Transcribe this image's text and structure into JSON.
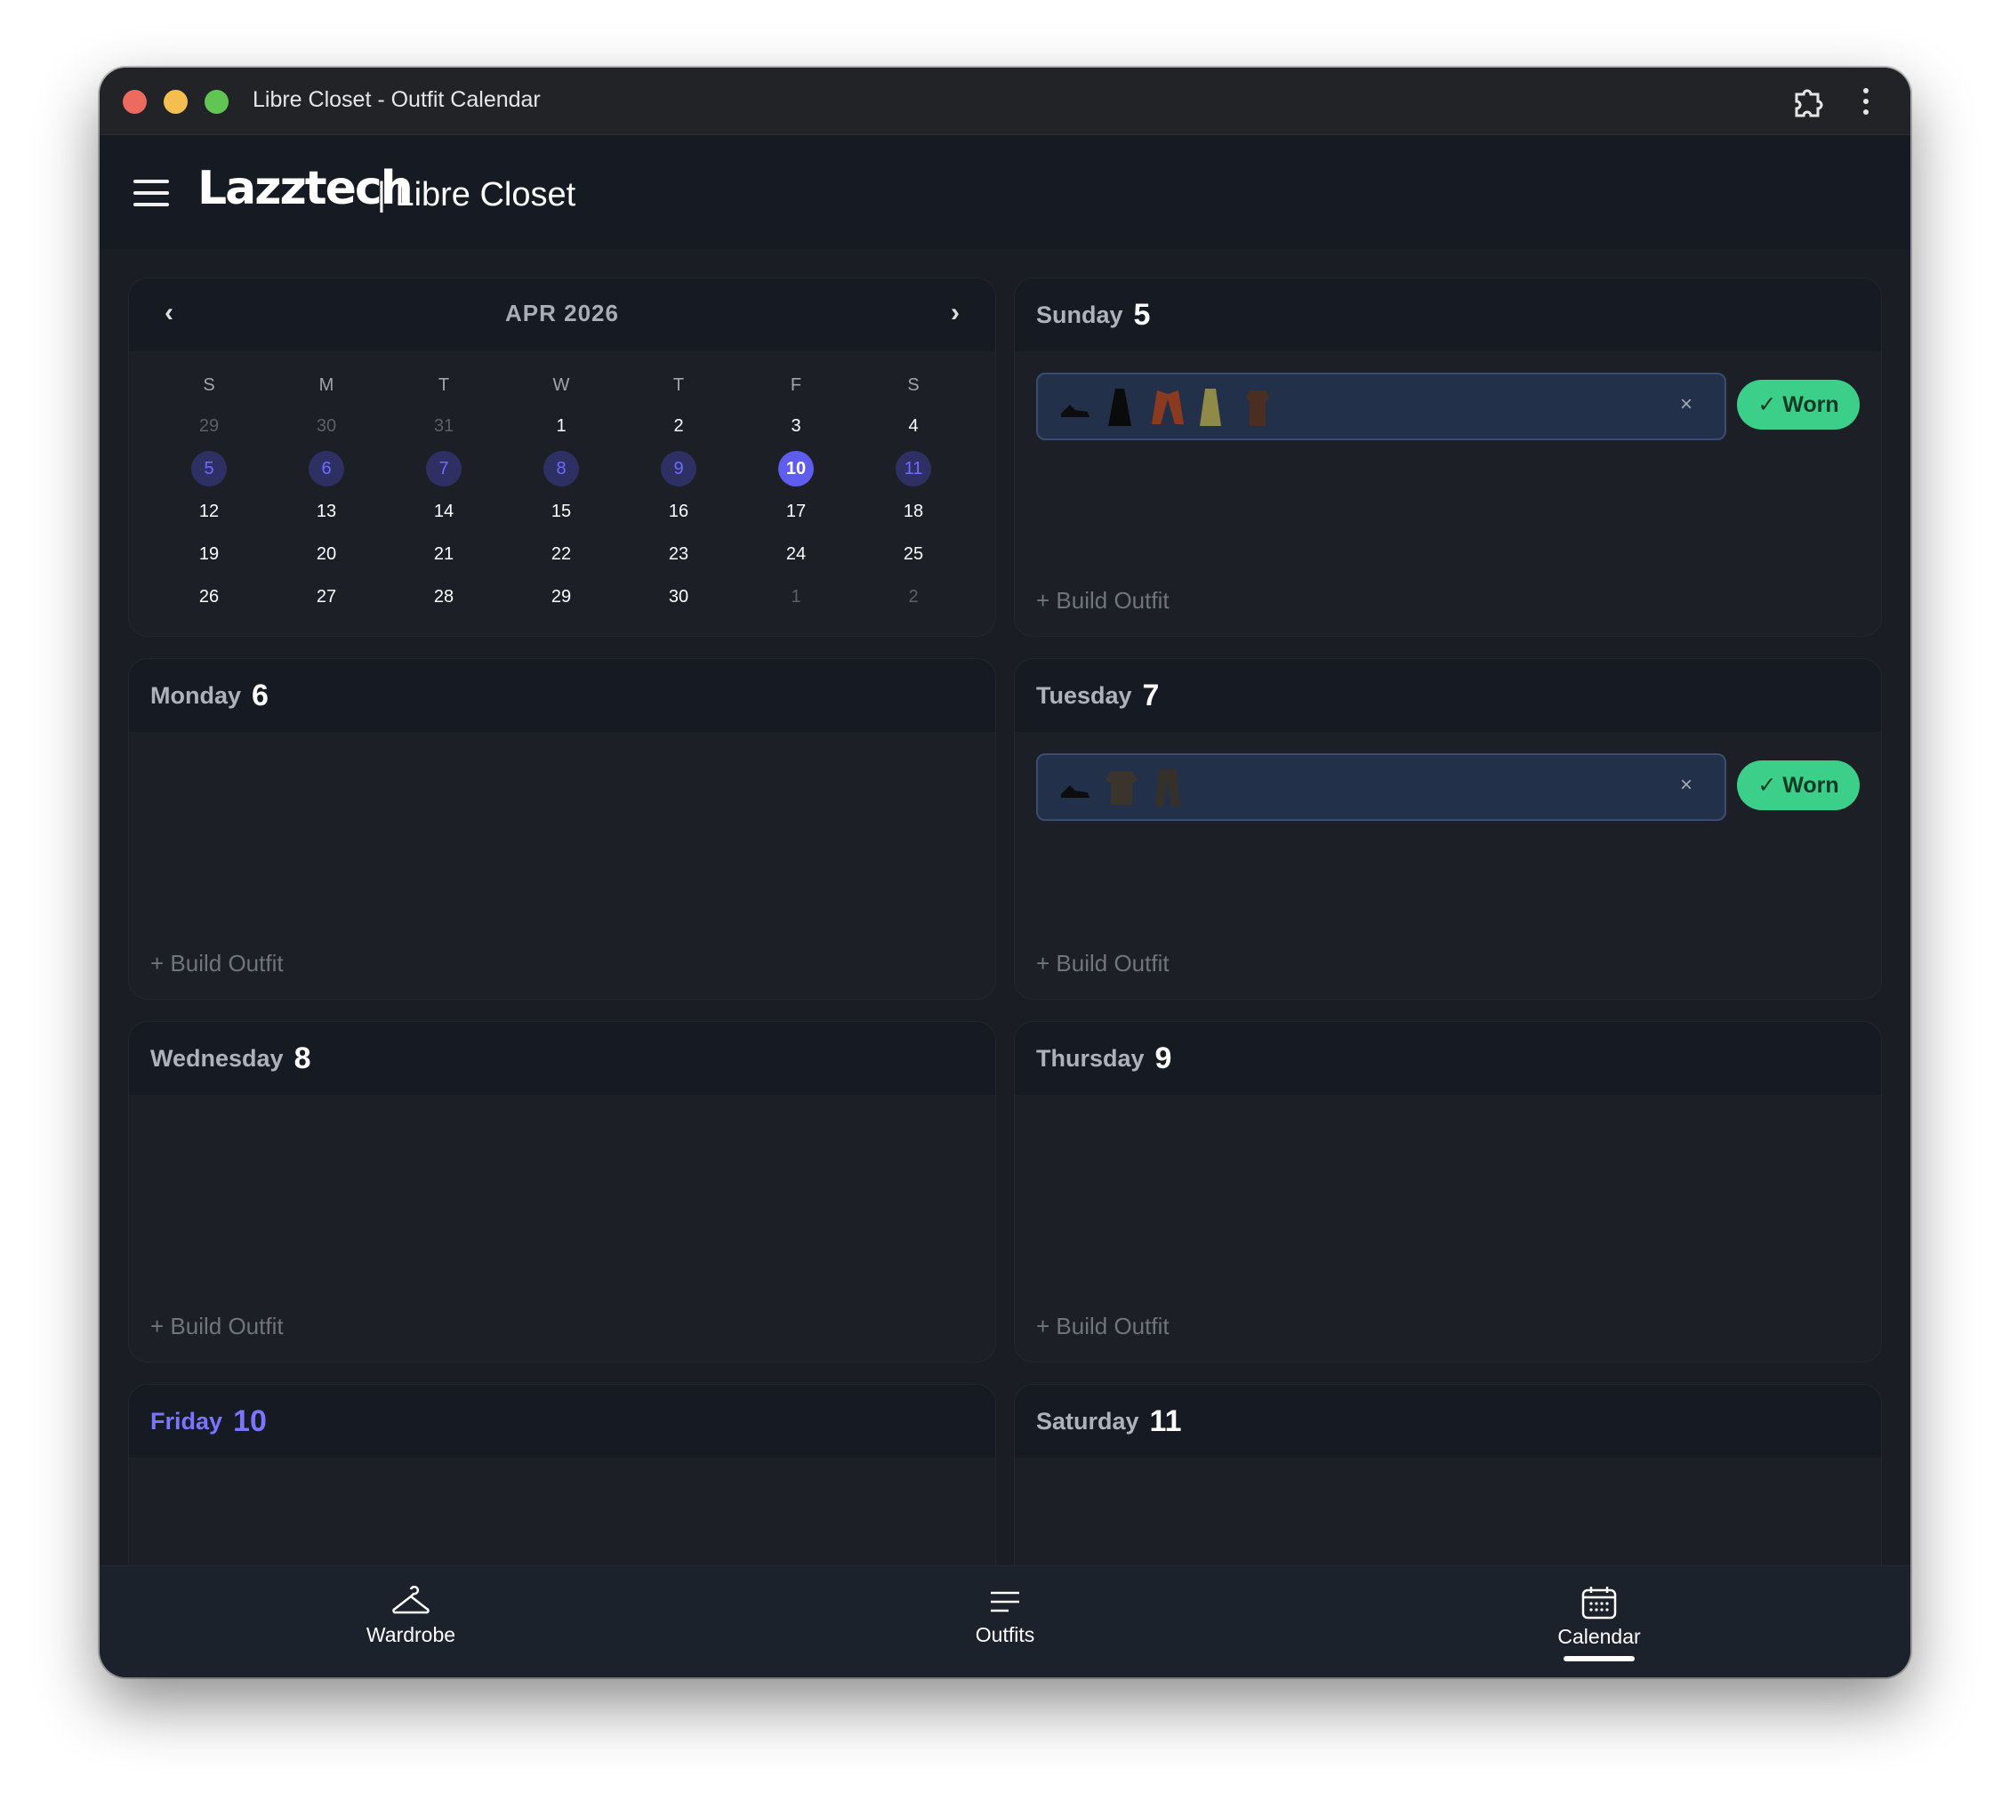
{
  "window": {
    "title": "Libre Closet - Outfit Calendar"
  },
  "appbar": {
    "logo_text": "Lazztech",
    "brand": "| Libre Closet"
  },
  "calendar": {
    "month_label": "APR 2026",
    "prev": "‹",
    "next": "›",
    "dow": [
      "S",
      "M",
      "T",
      "W",
      "T",
      "F",
      "S"
    ],
    "weeks": [
      [
        "29",
        "30",
        "31",
        "1",
        "2",
        "3",
        "4"
      ],
      [
        "5",
        "6",
        "7",
        "8",
        "9",
        "10",
        "11"
      ],
      [
        "12",
        "13",
        "14",
        "15",
        "16",
        "17",
        "18"
      ],
      [
        "19",
        "20",
        "21",
        "22",
        "23",
        "24",
        "25"
      ],
      [
        "26",
        "27",
        "28",
        "29",
        "30",
        "1",
        "2"
      ]
    ],
    "selected_day": "10",
    "current_week_row": 1
  },
  "days": [
    {
      "name": "Sunday",
      "num": "5",
      "has_outfit": true,
      "items": 5,
      "remove": "×",
      "worn": "✓ Worn",
      "build": "+ Build Outfit"
    },
    {
      "name": "Monday",
      "num": "6",
      "has_outfit": false,
      "build": "+ Build Outfit"
    },
    {
      "name": "Tuesday",
      "num": "7",
      "has_outfit": true,
      "items": 3,
      "remove": "×",
      "worn": "✓ Worn",
      "build": "+ Build Outfit"
    },
    {
      "name": "Wednesday",
      "num": "8",
      "has_outfit": false,
      "build": "+ Build Outfit"
    },
    {
      "name": "Thursday",
      "num": "9",
      "has_outfit": false,
      "build": "+ Build Outfit"
    },
    {
      "name": "Friday",
      "num": "10",
      "today": true
    },
    {
      "name": "Saturday",
      "num": "11"
    }
  ],
  "tabs": [
    {
      "label": "Wardrobe",
      "icon": "hanger-icon",
      "active": false
    },
    {
      "label": "Outfits",
      "icon": "list-icon",
      "active": false
    },
    {
      "label": "Calendar",
      "icon": "calendar-icon",
      "active": true
    }
  ],
  "colors": {
    "accent": "#5f5cf0",
    "worn": "#3ccf8a",
    "background": "#1a1d23"
  }
}
